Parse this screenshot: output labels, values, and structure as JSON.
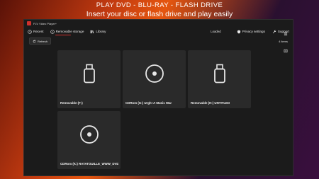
{
  "promo": {
    "line1": "PLAY DVD - BLU-RAY - FLASH DRIVE",
    "line2": "Insert your disc or flash drive and play easily"
  },
  "window": {
    "title": "FLV Video Player+"
  },
  "nav": {
    "recent": "Recent",
    "removable": "Removable storage",
    "library": "Library",
    "status": "Loaded",
    "privacy": "Privacy settings",
    "support": "Support"
  },
  "toolbar": {
    "refresh": "Refresh",
    "count": "4 items"
  },
  "drives": [
    {
      "label": "Removable (F:)",
      "icon": "usb-drive-icon"
    },
    {
      "label": "CDRom (G:) Urgh! A Music War",
      "icon": "disc-icon"
    },
    {
      "label": "Removable (H:) UNTITLED",
      "icon": "usb-drive-icon"
    },
    {
      "label": "CDRom (K:) RATATOUILLE_WWW_DVDFAB",
      "icon": "disc-icon"
    }
  ],
  "colors": {
    "accent": "#d0312d",
    "window_bg": "#1b1b1b",
    "card_bg": "#2a2a2a"
  }
}
